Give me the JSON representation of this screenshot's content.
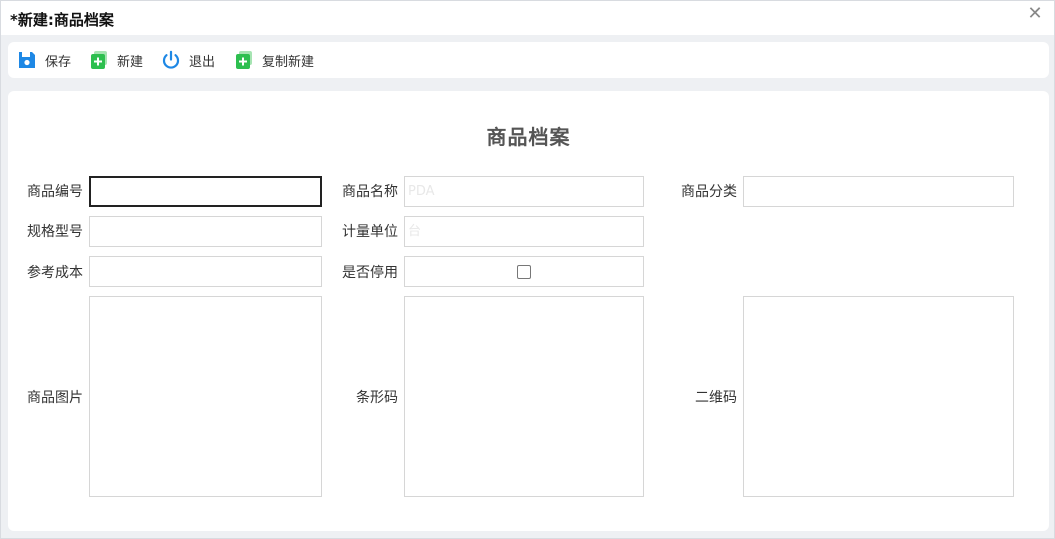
{
  "window": {
    "title": "*新建:商品档案",
    "close_glyph": "✕"
  },
  "toolbar": {
    "save_label": "保存",
    "new_label": "新建",
    "exit_label": "退出",
    "copy_new_label": "复制新建"
  },
  "form": {
    "title": "商品档案",
    "code_label": "商品编号",
    "code_value": "",
    "name_label": "商品名称",
    "name_value": "PDA",
    "category_label": "商品分类",
    "category_value": "",
    "spec_label": "规格型号",
    "spec_value": "",
    "unit_label": "计量单位",
    "unit_value": "台",
    "cost_label": "参考成本",
    "cost_value": "",
    "disabled_label": "是否停用",
    "disabled_checked": false,
    "image_label": "商品图片",
    "barcode_label": "条形码",
    "qrcode_label": "二维码"
  },
  "colors": {
    "save_icon": "#1e88e5",
    "new_icon": "#2dbf4f",
    "exit_icon": "#1e88e5"
  }
}
